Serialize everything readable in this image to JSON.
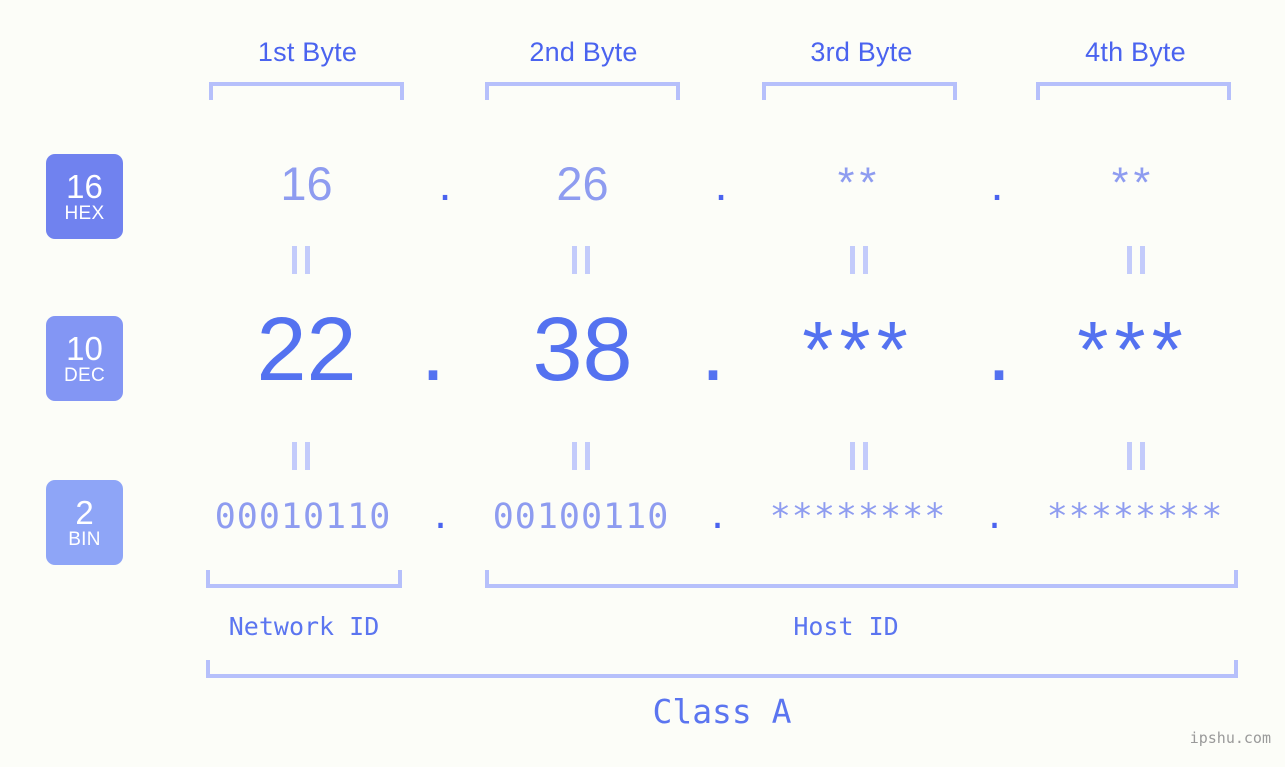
{
  "meta": {
    "watermark": "ipshu.com",
    "background": "#fcfdf8",
    "accent_strong": "#4a63ef",
    "accent_mid": "#5472f0",
    "accent_light": "#8e9cf0",
    "accent_pale": "#b6c0fb"
  },
  "byte_headers": [
    {
      "label": "1st Byte"
    },
    {
      "label": "2nd Byte"
    },
    {
      "label": "3rd Byte"
    },
    {
      "label": "4th Byte"
    }
  ],
  "bases": [
    {
      "num": "16",
      "abbr": "HEX",
      "color": "#7082ef"
    },
    {
      "num": "10",
      "abbr": "DEC",
      "color": "#8396f4"
    },
    {
      "num": "2",
      "abbr": "BIN",
      "color": "#8ea5f7"
    }
  ],
  "rows": {
    "hex": {
      "values": [
        "16",
        "26",
        "**",
        "**"
      ],
      "separators": [
        ".",
        ".",
        "."
      ]
    },
    "dec": {
      "values": [
        "22",
        "38",
        "***",
        "***"
      ],
      "separators": [
        ".",
        ".",
        "."
      ]
    },
    "bin": {
      "values": [
        "00010110",
        "00100110",
        "********",
        "********"
      ],
      "separators": [
        ".",
        ".",
        "."
      ]
    }
  },
  "equality_symbol": "||",
  "id_labels": {
    "network": "Network ID",
    "host": "Host ID"
  },
  "class_label": "Class A"
}
